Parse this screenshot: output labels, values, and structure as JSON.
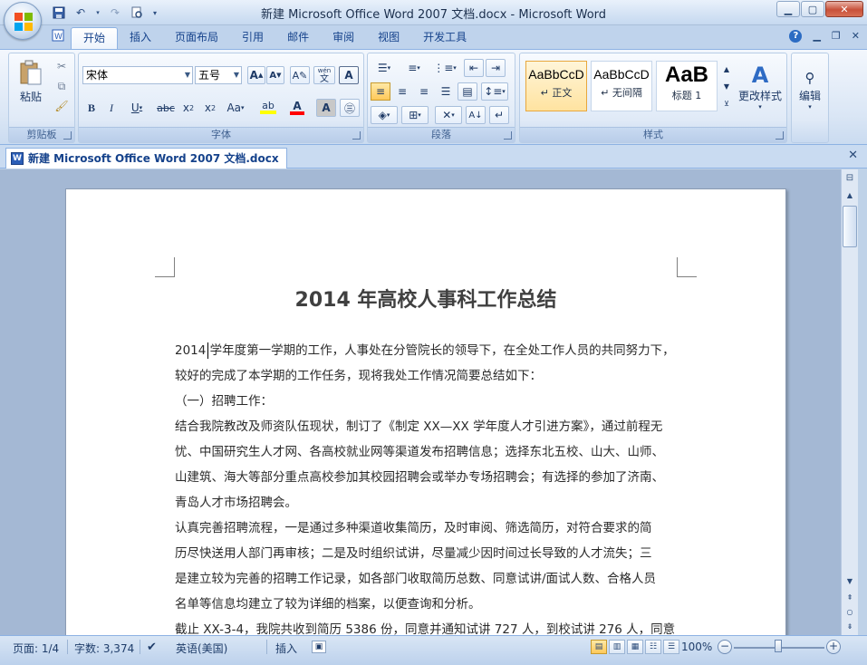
{
  "window": {
    "title": "新建 Microsoft Office Word 2007 文档.docx - Microsoft Word"
  },
  "ribbon_tabs": [
    "开始",
    "插入",
    "页面布局",
    "引用",
    "邮件",
    "审阅",
    "视图",
    "开发工具"
  ],
  "ribbon": {
    "clipboard": {
      "paste_label": "粘贴",
      "group_label": "剪贴板"
    },
    "font": {
      "font_name": "宋体",
      "font_size": "五号",
      "group_label": "字体"
    },
    "paragraph": {
      "group_label": "段落"
    },
    "styles": {
      "items": [
        {
          "sample": "AaBbCcD",
          "name": "↵ 正文"
        },
        {
          "sample": "AaBbCcD",
          "name": "↵ 无间隔"
        },
        {
          "sample": "AaB",
          "name": "标题 1"
        }
      ],
      "change_styles_label": "更改样式",
      "group_label": "样式"
    },
    "editing": {
      "label": "编辑"
    }
  },
  "document_tab": {
    "label": "新建 Microsoft Office Word 2007 文档.docx"
  },
  "document": {
    "title": "2014 年高校人事科工作总结",
    "lines": [
      "2014 学年度第一学期的工作，人事处在分管院长的领导下，在全处工作人员的共同努力下，",
      "较好的完成了本学期的工作任务，现将我处工作情况简要总结如下：",
      "（一）招聘工作：",
      "结合我院教改及师资队伍现状，制订了《制定 XX—XX 学年度人才引进方案》，通过前程无",
      "忧、中国研究生人才网、各高校就业网等渠道发布招聘信息；选择东北五校、山大、山师、",
      "山建筑、海大等部分重点高校参加其校园招聘会或举办专场招聘会；有选择的参加了济南、",
      "青岛人才市场招聘会。",
      "认真完善招聘流程，一是通过多种渠道收集简历，及时审阅、筛选简历，对符合要求的简",
      "历尽快送用人部门再审核；二是及时组织试讲，尽量减少因时间过长导致的人才流失；三",
      "是建立较为完善的招聘工作记录，如各部门收取简历总数、同意试讲/面试人数、合格人员",
      "名单等信息均建立了较为详细的档案，以便查询和分析。",
      "截止 XX-3-4，我院共收到简历 5386 份，同意并通知试讲 727 人，到校试讲 276 人，同意"
    ]
  },
  "status_bar": {
    "page": "页面: 1/4",
    "words": "字数: 3,374",
    "language": "英语(美国)",
    "mode": "插入",
    "zoom": "100%"
  },
  "colors": {
    "ribbon_text": "#15428b",
    "workspace": "#a4b8d4",
    "font_color_red": "#ff0000",
    "highlight_yellow": "#ffff00"
  }
}
